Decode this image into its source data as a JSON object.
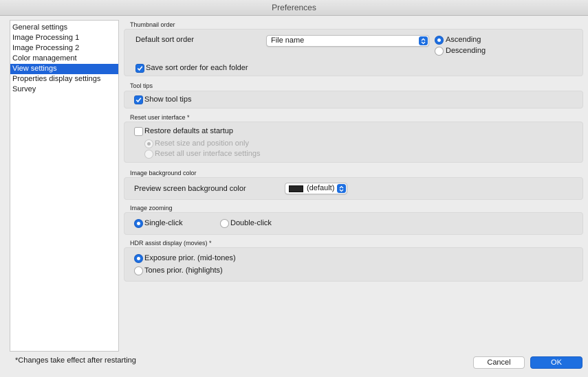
{
  "window": {
    "title": "Preferences"
  },
  "sidebar": {
    "items": [
      {
        "label": "General settings",
        "selected": false
      },
      {
        "label": "Image Processing 1",
        "selected": false
      },
      {
        "label": "Image Processing 2",
        "selected": false
      },
      {
        "label": "Color management",
        "selected": false
      },
      {
        "label": "View settings",
        "selected": true
      },
      {
        "label": "Properties display settings",
        "selected": false
      },
      {
        "label": "Survey",
        "selected": false
      }
    ]
  },
  "thumbnail_order": {
    "section_label": "Thumbnail order",
    "sort_label": "Default sort order",
    "sort_value": "File name",
    "ascending_label": "Ascending",
    "ascending_selected": true,
    "descending_label": "Descending",
    "descending_selected": false,
    "save_per_folder_label": "Save sort order for each folder",
    "save_per_folder_checked": true
  },
  "tool_tips": {
    "section_label": "Tool tips",
    "show_label": "Show tool tips",
    "show_checked": true
  },
  "reset_ui": {
    "section_label": "Reset user interface *",
    "restore_label": "Restore defaults at startup",
    "restore_checked": false,
    "size_position_label": "Reset size and position only",
    "size_position_selected": true,
    "all_settings_label": "Reset all user interface settings",
    "all_settings_selected": false
  },
  "image_background": {
    "section_label": "Image background color",
    "preview_label": "Preview screen background color",
    "color_value": "(default)",
    "swatch_color": "#262626"
  },
  "image_zooming": {
    "section_label": "Image zooming",
    "single_click_label": "Single-click",
    "single_click_selected": true,
    "double_click_label": "Double-click",
    "double_click_selected": false
  },
  "hdr_assist": {
    "section_label": "HDR assist display (movies) *",
    "exposure_label": "Exposure prior. (mid-tones)",
    "exposure_selected": true,
    "tones_label": "Tones prior. (highlights)",
    "tones_selected": false
  },
  "footer": {
    "note": "*Changes take effect after restarting",
    "cancel_label": "Cancel",
    "ok_label": "OK"
  },
  "colors": {
    "accent": "#1e6fe0",
    "selection": "#1e64d8"
  }
}
